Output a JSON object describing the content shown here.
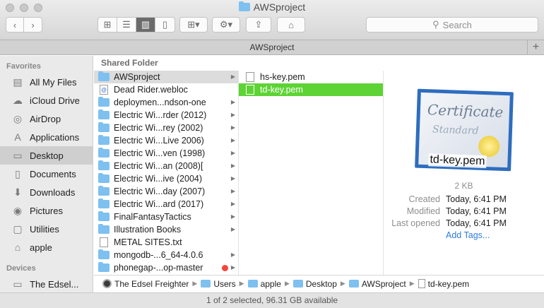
{
  "window": {
    "title": "AWSproject"
  },
  "toolbar": {
    "search_placeholder": "Search",
    "back_icon": "chevron-left-icon",
    "forward_icon": "chevron-right-icon"
  },
  "tab": {
    "label": "AWSproject",
    "add_label": "+"
  },
  "sidebar": {
    "favorites_header": "Favorites",
    "devices_header": "Devices",
    "items": [
      {
        "label": "All My Files",
        "icon": "▤"
      },
      {
        "label": "iCloud Drive",
        "icon": "☁"
      },
      {
        "label": "AirDrop",
        "icon": "◎"
      },
      {
        "label": "Applications",
        "icon": "A"
      },
      {
        "label": "Desktop",
        "icon": "▭"
      },
      {
        "label": "Documents",
        "icon": "▯"
      },
      {
        "label": "Downloads",
        "icon": "⬇"
      },
      {
        "label": "Pictures",
        "icon": "◉"
      },
      {
        "label": "Utilities",
        "icon": "▢"
      },
      {
        "label": "apple",
        "icon": "⌂"
      }
    ],
    "devices": [
      {
        "label": "The Edsel...",
        "icon": "▭"
      }
    ]
  },
  "column_header": "Shared Folder",
  "column1": [
    {
      "label": "AWSproject",
      "type": "folder",
      "arrow": true
    },
    {
      "label": "Dead Rider.webloc",
      "type": "webloc",
      "arrow": false
    },
    {
      "label": "deploymen...ndson-one",
      "type": "folder",
      "arrow": true
    },
    {
      "label": "Electric Wi...rder (2012)",
      "type": "folder",
      "arrow": true
    },
    {
      "label": "Electric Wi...rey (2002)",
      "type": "folder",
      "arrow": true
    },
    {
      "label": "Electric Wi...Live 2006)",
      "type": "folder",
      "arrow": true
    },
    {
      "label": "Electric Wi...ven (1998)",
      "type": "folder",
      "arrow": true
    },
    {
      "label": "Electric Wi...an (2008)[",
      "type": "folder",
      "arrow": true
    },
    {
      "label": "Electric Wi...ive (2004)",
      "type": "folder",
      "arrow": true
    },
    {
      "label": "Electric Wi...day (2007)",
      "type": "folder",
      "arrow": true
    },
    {
      "label": "Electric Wi...ard (2017)",
      "type": "folder",
      "arrow": true
    },
    {
      "label": "FinalFantasyTactics",
      "type": "folder",
      "arrow": true
    },
    {
      "label": "Illustration Books",
      "type": "folder",
      "arrow": true
    },
    {
      "label": "METAL SITES.txt",
      "type": "doc",
      "arrow": false
    },
    {
      "label": "mongodb-...6_64-4.0.6",
      "type": "folder",
      "arrow": true
    },
    {
      "label": "phonegap-...op-master",
      "type": "folder",
      "arrow": true
    }
  ],
  "column2": [
    {
      "label": "hs-key.pem"
    },
    {
      "label": "td-key.pem"
    }
  ],
  "preview": {
    "cert_title": "Certificate",
    "cert_subtitle": "Standard",
    "file_name": "td-key.pem",
    "size": "2 KB",
    "created_label": "Created",
    "created_value": "Today, 6:41 PM",
    "modified_label": "Modified",
    "modified_value": "Today, 6:41 PM",
    "opened_label": "Last opened",
    "opened_value": "Today, 6:41 PM",
    "add_tags": "Add Tags..."
  },
  "pathbar": {
    "items": [
      "The Edsel Freighter",
      "Users",
      "apple",
      "Desktop",
      "AWSproject",
      "td-key.pem"
    ]
  },
  "status": "1 of 2 selected, 96.31 GB available",
  "colors": {
    "selection": "#5ed335",
    "folder": "#7ec0ef",
    "tag_red": "#f2463d"
  }
}
